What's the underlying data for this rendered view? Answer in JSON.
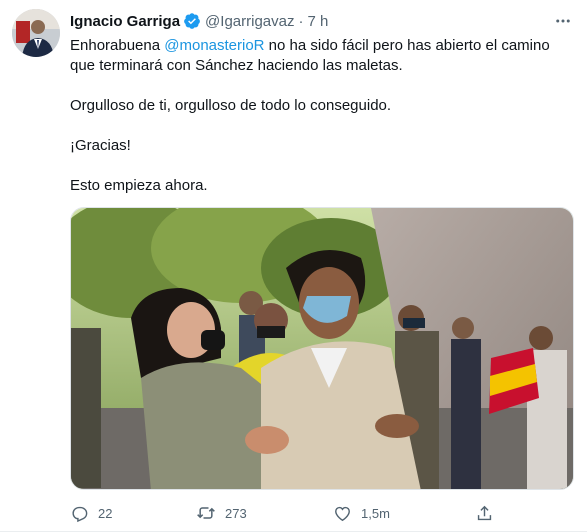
{
  "author": {
    "display_name": "Ignacio Garriga",
    "handle": "@Igarrigavaz",
    "separator": "·",
    "time": "7 h",
    "verified": true
  },
  "tweet": {
    "line1_pre": "Enhorabuena ",
    "mention": "@monasterioR",
    "line1_post": " no ha sido fácil pero has abierto el camino que terminará con Sánchez haciendo las maletas.",
    "paragraph2": "Orgulloso de ti, orgulloso de todo lo conseguido.",
    "paragraph3": "¡Gracias!",
    "paragraph4": "Esto empieza ahora."
  },
  "actions": {
    "reply_count": "22",
    "retweet_count": "273",
    "like_count": "1,5m"
  },
  "colors": {
    "accent": "#1b95e0",
    "muted": "#536471",
    "verified": "#1d9bf0"
  },
  "icons": {
    "verified": "verified-badge-icon",
    "more": "more-dots-icon",
    "reply": "reply-icon",
    "retweet": "retweet-icon",
    "like": "heart-icon",
    "share": "share-icon"
  }
}
